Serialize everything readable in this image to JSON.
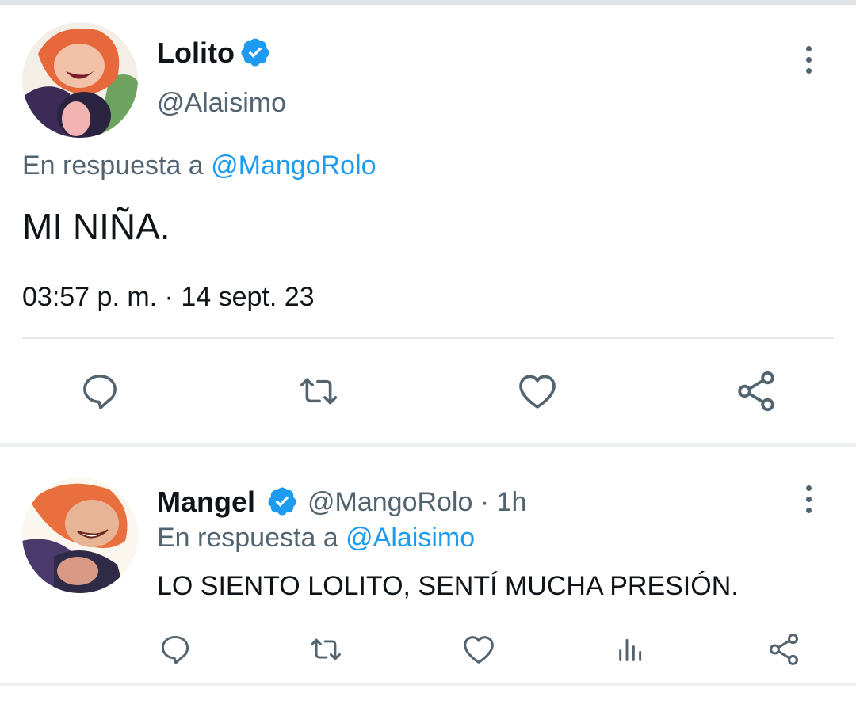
{
  "main_tweet": {
    "display_name": "Lolito",
    "handle": "@Alaisimo",
    "reply_prefix": "En respuesta a",
    "reply_to": "@MangoRolo",
    "text": "MI NIÑA.",
    "timestamp": "03:57 p. m. · 14 sept. 23",
    "actions": [
      "reply-icon",
      "retweet-icon",
      "like-icon",
      "share-icon"
    ]
  },
  "reply_tweet": {
    "display_name": "Mangel",
    "handle_time": "@MangoRolo · 1h",
    "reply_prefix": "En respuesta a",
    "reply_to": "@Alaisimo",
    "text": "LO SIENTO LOLITO, SENTÍ MUCHA PRESIÓN.",
    "actions": [
      "reply-icon",
      "retweet-icon",
      "like-icon",
      "analytics-icon",
      "share-icon"
    ]
  },
  "colors": {
    "accent": "#1d9bf0",
    "muted": "#536471",
    "text": "#0f1419",
    "divider": "#e6e8ea"
  }
}
